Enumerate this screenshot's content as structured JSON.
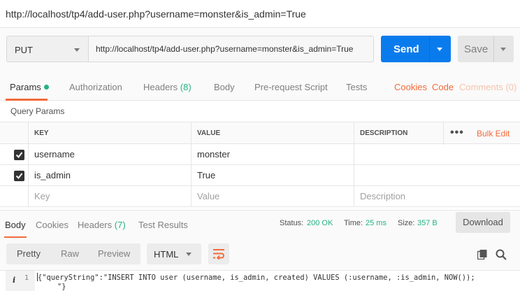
{
  "title": "http://localhost/tp4/add-user.php?username=monster&is_admin=True",
  "request": {
    "method": "PUT",
    "url": "http://localhost/tp4/add-user.php?username=monster&is_admin=True",
    "send_label": "Send",
    "save_label": "Save"
  },
  "request_tabs": {
    "params": "Params",
    "authorization": "Authorization",
    "headers": "Headers",
    "headers_count": "(8)",
    "body": "Body",
    "prerequest": "Pre-request Script",
    "tests": "Tests",
    "cookies": "Cookies",
    "code": "Code",
    "comments": "Comments (0)"
  },
  "query_params": {
    "title": "Query Params",
    "columns": {
      "key": "KEY",
      "value": "VALUE",
      "description": "DESCRIPTION"
    },
    "more": "•••",
    "bulk_edit": "Bulk Edit",
    "rows": [
      {
        "key": "username",
        "value": "monster",
        "checked": true
      },
      {
        "key": "is_admin",
        "value": "True",
        "checked": true
      }
    ],
    "placeholders": {
      "key": "Key",
      "value": "Value",
      "description": "Description"
    }
  },
  "response_tabs": {
    "body": "Body",
    "cookies": "Cookies",
    "headers": "Headers",
    "headers_count": "(7)",
    "test_results": "Test Results"
  },
  "status": {
    "status_label": "Status:",
    "status_value": "200 OK",
    "time_label": "Time:",
    "time_value": "25 ms",
    "size_label": "Size:",
    "size_value": "357 B"
  },
  "download_label": "Download",
  "view_modes": {
    "pretty": "Pretty",
    "raw": "Raw",
    "preview": "Preview"
  },
  "format": "HTML",
  "icons": {
    "wrap": "wrap-lines-icon",
    "copy": "copy-icon",
    "search": "search-icon",
    "info": "info-icon"
  },
  "editor": {
    "info_glyph": "i",
    "line_number": "1",
    "line1": "{\"queryString\":\"INSERT INTO user (username, is_admin, created) VALUES (:username, :is_admin, NOW());",
    "line2": "\"}"
  },
  "colors": {
    "accent": "#f26b3a",
    "send": "#097bed",
    "success": "#26b47f"
  }
}
